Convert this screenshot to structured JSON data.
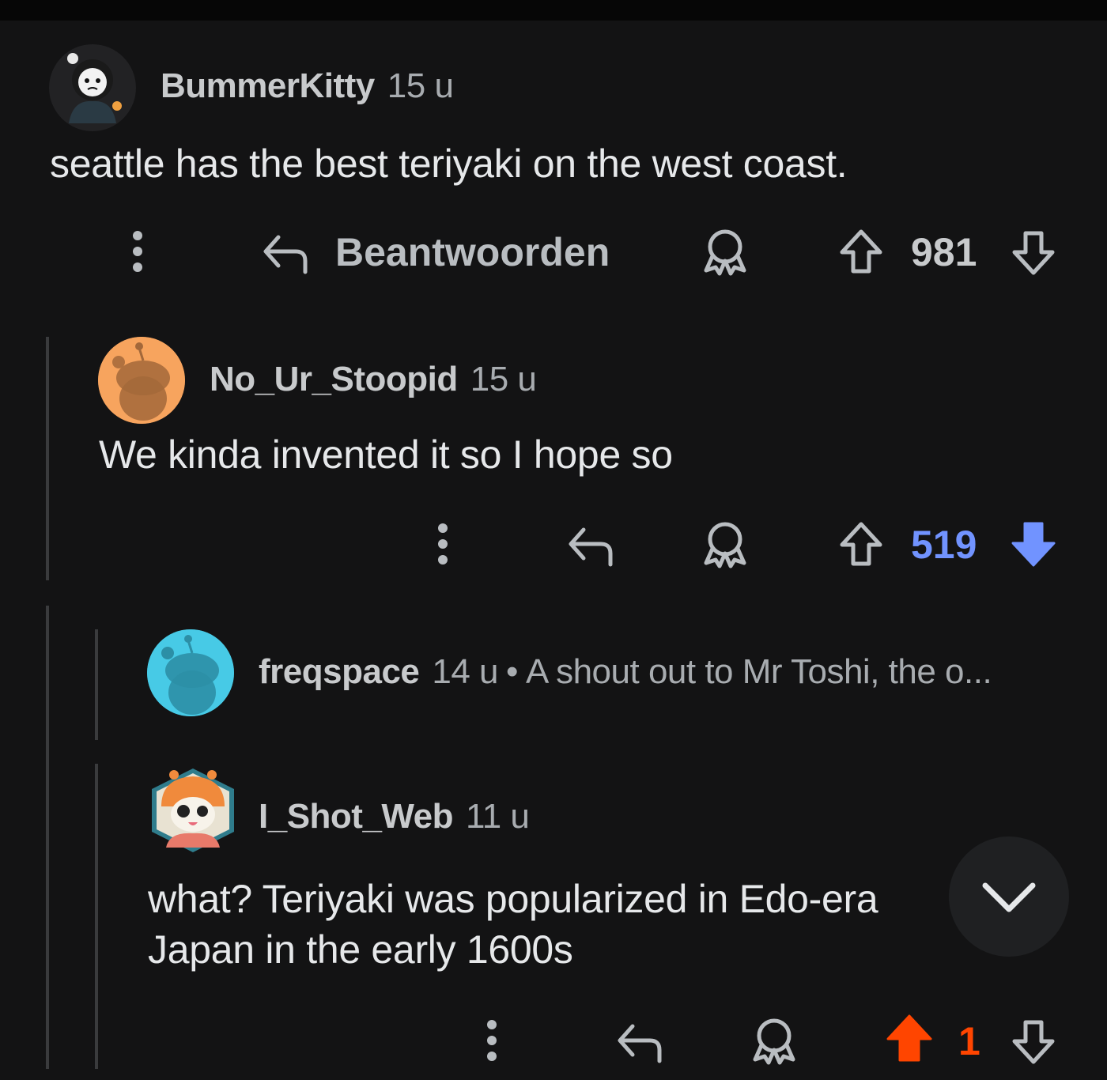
{
  "comments": [
    {
      "username": "BummerKitty",
      "age": "15 u",
      "text": "seattle has the best teriyaki on the west coast.",
      "reply_label": "Beantwoorden",
      "score": "981",
      "vote_state": "none"
    },
    {
      "username": "No_Ur_Stoopid",
      "age": "15 u",
      "text": "We kinda invented it so I hope so",
      "score": "519",
      "vote_state": "downvoted"
    },
    {
      "username": "freqspace",
      "age": "14 u",
      "separator": "•",
      "collapsed_preview": "A shout out to Mr Toshi, the o...",
      "collapsed": true
    },
    {
      "username": "I_Shot_Web",
      "age": "11 u",
      "text_line1": "what? Teriyaki was popularized in Edo-era",
      "text_line2": "Japan in the early 1600s",
      "score": "1",
      "vote_state": "upvoted"
    }
  ],
  "colors": {
    "background": "#131314",
    "downvote_blue": "#7193ff",
    "upvote_orange": "#ff4500",
    "icon_gray": "#b9bdc1"
  },
  "icons": [
    "more-vertical-icon",
    "reply-icon",
    "award-icon",
    "upvote-icon",
    "downvote-icon",
    "chevron-down-icon"
  ]
}
